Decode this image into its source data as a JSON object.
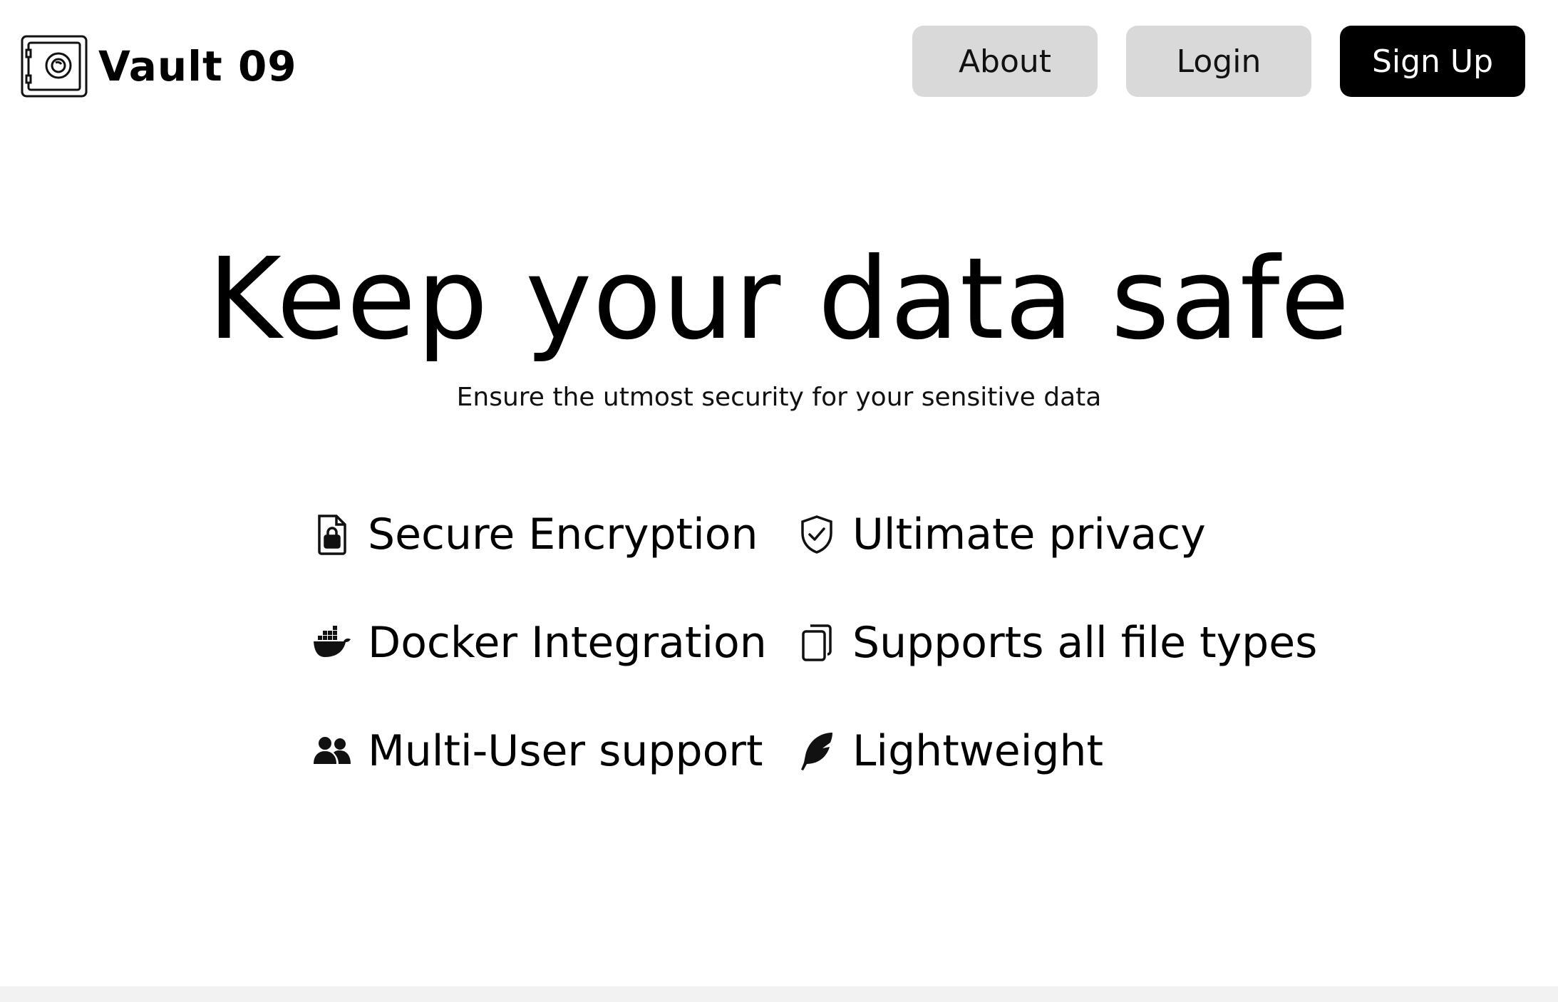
{
  "header": {
    "brand_name": "Vault 09",
    "logo_icon": "safe-icon",
    "nav": {
      "about_label": "About",
      "login_label": "Login",
      "signup_label": "Sign Up"
    }
  },
  "hero": {
    "title": "Keep your data safe",
    "subtitle": "Ensure the utmost security for your sensitive data"
  },
  "features": [
    {
      "label": "Secure Encryption",
      "icon": "file-lock-icon"
    },
    {
      "label": "Ultimate privacy",
      "icon": "shield-check-icon"
    },
    {
      "label": "Docker Integration",
      "icon": "docker-icon"
    },
    {
      "label": "Supports all file types",
      "icon": "files-icon"
    },
    {
      "label": "Multi-User support",
      "icon": "users-icon"
    },
    {
      "label": "Lightweight",
      "icon": "feather-icon"
    }
  ],
  "colors": {
    "background": "#ffffff",
    "text": "#000000",
    "secondary_button": "#d9d9d9",
    "primary_button": "#000000",
    "primary_button_text": "#ffffff"
  }
}
